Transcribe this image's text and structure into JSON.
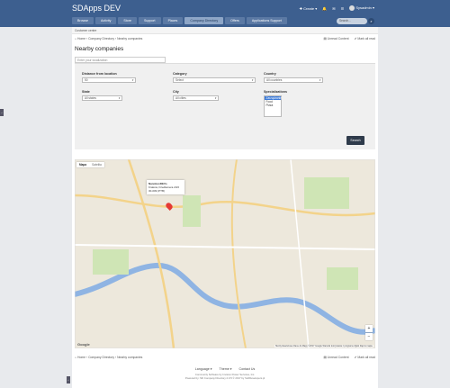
{
  "app": {
    "title": "SDApps DEV"
  },
  "topbar": {
    "create_label": "Create",
    "user_label": "Sysadmin",
    "badge": "2"
  },
  "nav": [
    "Browse",
    "Activity",
    "Store",
    "Support",
    "Places",
    "Company Directory",
    "Offers",
    "Applications Support"
  ],
  "search": {
    "placeholder": "Search..."
  },
  "subbar": {
    "text": "Customer centre"
  },
  "breadcrumb": {
    "home": "Home",
    "section": "Company Directory",
    "current": "Nearby companies",
    "unread": "Unread Content",
    "mark": "Mark all read"
  },
  "page": {
    "title": "Nearby companies"
  },
  "form": {
    "location_placeholder": "Enter your localization",
    "distance_label": "Distance from location",
    "distance_value": "50",
    "category_label": "Category",
    "category_value": "Select",
    "country_label": "Country",
    "country_value": "All countries",
    "state_label": "State",
    "state_value": "All states",
    "city_label": "City",
    "city_value": "All cities",
    "spec_label": "Specializations",
    "spec_options": [
      "Zarządzanie",
      "Food",
      "Pizza"
    ],
    "search_button": "Search"
  },
  "map": {
    "tab_map": "Mapa",
    "tab_sat": "Satelita",
    "popup_title": "NanoboxDEVs",
    "popup_line1": "Kraków, Friedleinera 23/2",
    "popup_line2": "30-009 (PTB)",
    "zoom_in": "+",
    "zoom_out": "−",
    "google": "Google",
    "attribution": "Skróty klawiszowe  Dane do Mapy ©2017 Google  Warunki korzystania z programu  Zgłoś błąd w mapie"
  },
  "footer": {
    "language": "Language",
    "theme": "Theme",
    "contact": "Contact Us",
    "line1": "Community Software by Invision Power Services, Inc.",
    "line2": "Powered by: SD Company Directory 2.0.5 © 2017 by SoftDevelopers.pl"
  },
  "colors": {
    "topbar": "#3d5f8f",
    "accent": "#3c7bd9",
    "button": "#2f3b4b"
  }
}
